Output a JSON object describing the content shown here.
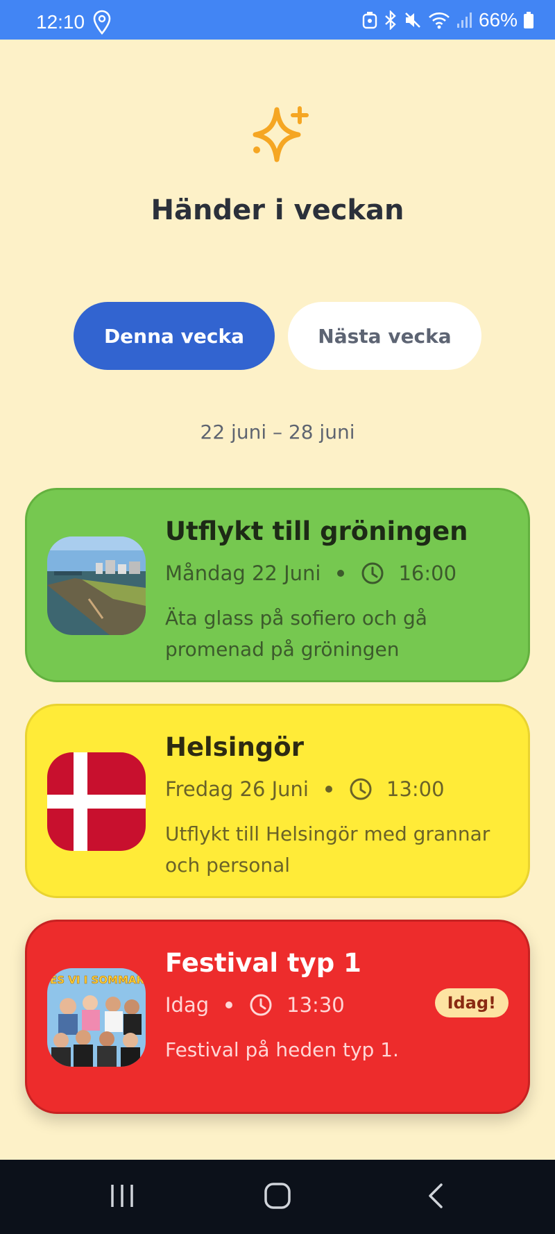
{
  "status_bar": {
    "time": "12:10",
    "battery": "66%",
    "icons": [
      "location-icon",
      "alarm-icon",
      "bluetooth-icon",
      "mute-icon",
      "wifi-icon",
      "signal-icon",
      "battery-icon"
    ],
    "color": "#4285f4"
  },
  "header": {
    "icon": "sparkle-icon",
    "title": "Händer i veckan"
  },
  "tabs": [
    {
      "label": "Denna vecka",
      "active": true
    },
    {
      "label": "Nästa vecka",
      "active": false
    }
  ],
  "date_range": "22 juni – 28 juni",
  "events": [
    {
      "title": "Utflykt till gröningen",
      "day": "Måndag 22 Juni",
      "time": "16:00",
      "description": "Äta glass på sofiero och gå promenad på gröningen",
      "color": "#76c850",
      "image": "harbor-promenade-photo"
    },
    {
      "title": "Helsingör",
      "day": "Fredag 26 Juni",
      "time": "13:00",
      "description": "Utflykt till Helsingör med grannar och personal",
      "color": "#ffeb38",
      "image": "danish-flag"
    },
    {
      "title": "Festival typ 1",
      "day": "Idag",
      "time": "13:30",
      "description": "Festival på heden typ 1.",
      "color": "#ed2c2c",
      "image": "festival-poster",
      "poster_text": "SES VI I SOMMAR?",
      "badge": "Idag!"
    }
  ],
  "nav_bar": {
    "buttons": [
      "recent-apps-icon",
      "home-icon",
      "back-icon"
    ]
  }
}
